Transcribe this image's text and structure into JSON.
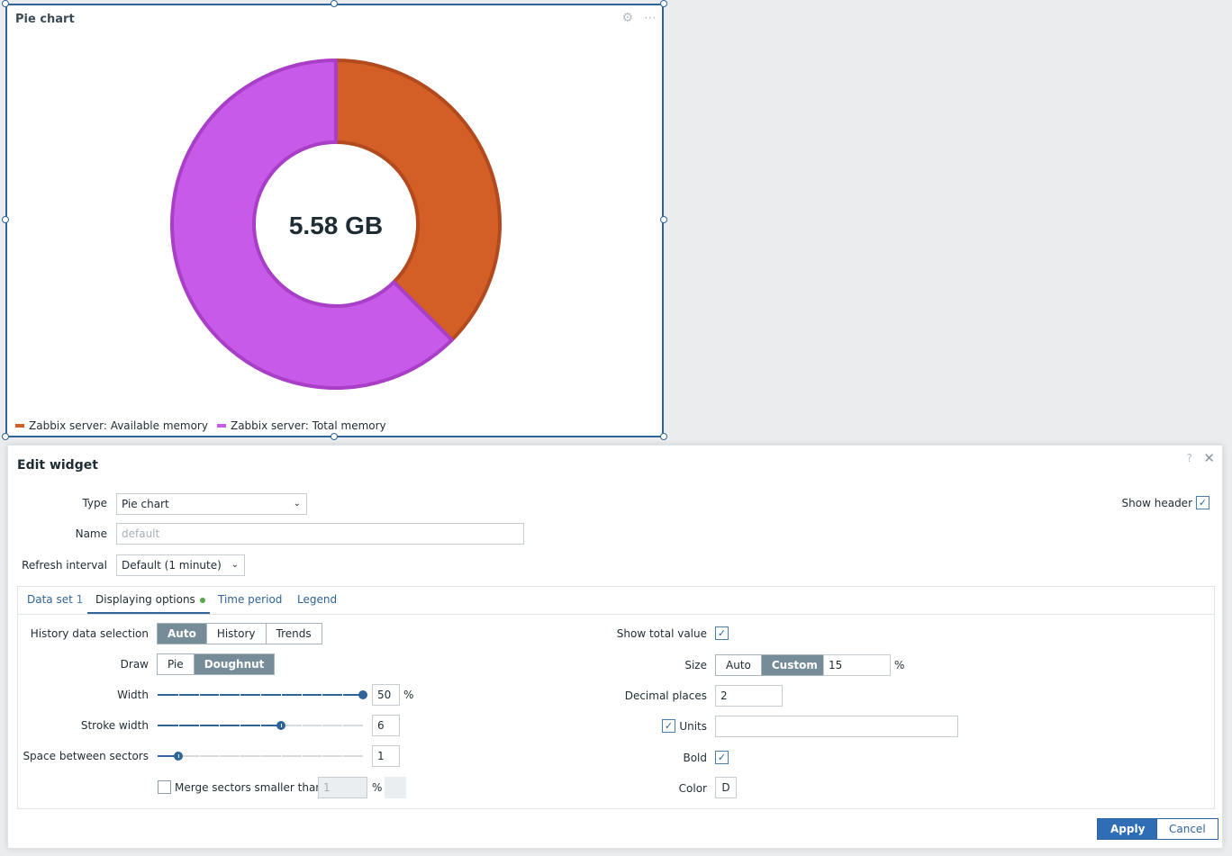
{
  "widget": {
    "title": "Pie chart",
    "center_value": "5.58 GB",
    "legend": [
      {
        "label": "Zabbix server: Available memory",
        "color": "#d35f27"
      },
      {
        "label": "Zabbix server: Total memory",
        "color": "#c75ae9"
      }
    ]
  },
  "chart_data": {
    "type": "pie",
    "style": "doughnut",
    "slices": [
      {
        "name": "Zabbix server: Available memory",
        "value": 37.5,
        "color": "#d35f27",
        "stroke": "#b24a1d"
      },
      {
        "name": "Zabbix server: Total memory",
        "value": 62.5,
        "color": "#c75ae9",
        "stroke": "#a93fc7"
      }
    ],
    "total_label": "5.58 GB",
    "doughnut_width_percent": 50
  },
  "dialog": {
    "title": "Edit widget",
    "help": "?",
    "close": "✕",
    "type_label": "Type",
    "type_value": "Pie chart",
    "name_label": "Name",
    "name_placeholder": "default",
    "refresh_label": "Refresh interval",
    "refresh_value": "Default (1 minute)",
    "show_header_label": "Show header",
    "show_header_checked": true,
    "tabs": [
      "Data set",
      "Displaying options",
      "Time period",
      "Legend"
    ],
    "dataset_count": "1",
    "history_label": "History data selection",
    "history_options": [
      "Auto",
      "History",
      "Trends"
    ],
    "history_selected": "Auto",
    "draw_label": "Draw",
    "draw_options": [
      "Pie",
      "Doughnut"
    ],
    "draw_selected": "Doughnut",
    "width_label": "Width",
    "width_value": "50",
    "width_level": 1.0,
    "stroke_label": "Stroke width",
    "stroke_value": "6",
    "stroke_level": 0.6,
    "space_label": "Space between sectors",
    "space_value": "1",
    "space_level": 0.1,
    "merge_label": "Merge sectors smaller than",
    "merge_value": "1",
    "percent": "%",
    "show_total_label": "Show total value",
    "size_label": "Size",
    "size_options": [
      "Auto",
      "Custom"
    ],
    "size_selected": "Custom",
    "size_value": "15",
    "decimal_label": "Decimal places",
    "decimal_value": "2",
    "units_label": "Units",
    "units_value": "",
    "bold_label": "Bold",
    "color_label": "Color",
    "color_value": "D",
    "apply_label": "Apply",
    "cancel_label": "Cancel"
  }
}
